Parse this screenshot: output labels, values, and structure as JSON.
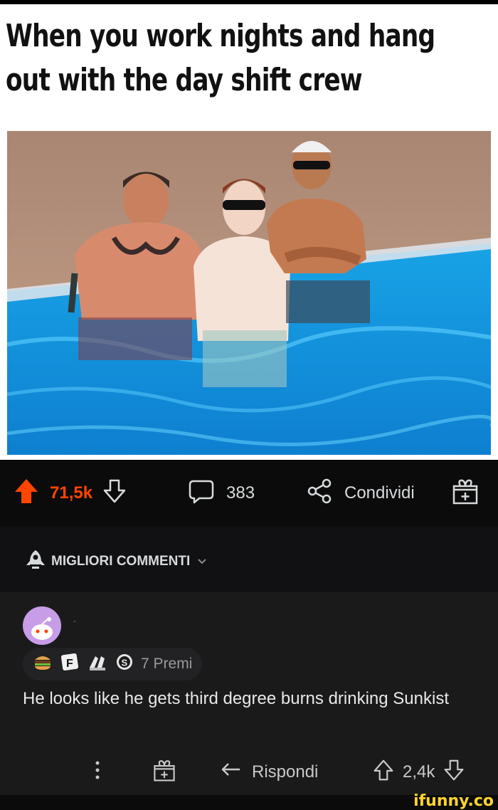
{
  "meme": {
    "caption_line1": "When you work nights and hang",
    "caption_line2": "out with the day shift crew"
  },
  "actions": {
    "upvote_count": "71,5k",
    "comment_count": "383",
    "share_label": "Condividi"
  },
  "sort": {
    "label": "MIGLIORI COMMENTI"
  },
  "comment": {
    "username": "·",
    "awards_label": "7 Premi",
    "text": "He looks like he gets third degree burns drinking Sunkist",
    "reply_label": "Rispondi",
    "vote_count": "2,4k"
  },
  "watermark": "ifunny.co",
  "colors": {
    "accent": "#ff4500",
    "background": "#0b0b0b",
    "comment_bg": "#1a1a1b",
    "avatar": "#c69de6"
  }
}
